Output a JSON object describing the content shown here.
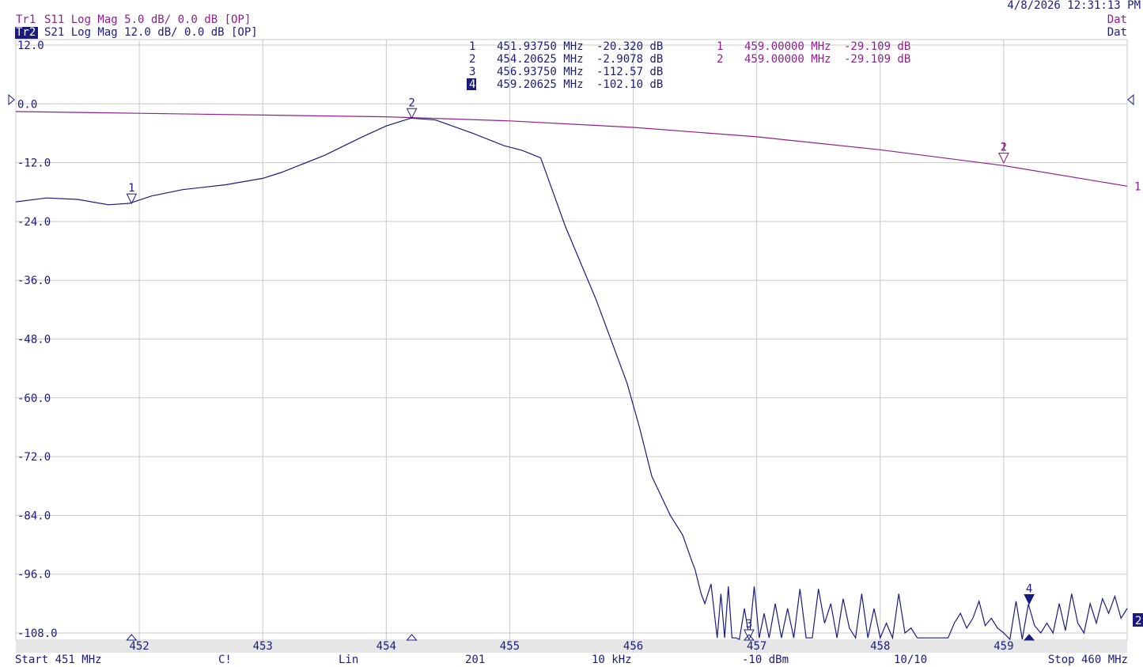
{
  "header": {
    "datetime": "4/8/2026 12:31:13 PM",
    "trace1": {
      "tag": "Tr1",
      "text": "S11 Log Mag 5.0 dB/ 0.0 dB [OP]",
      "status": "Dat"
    },
    "trace2": {
      "tag": "Tr2",
      "text": "S21 Log Mag 12.0 dB/ 0.0 dB [OP]",
      "status": "Dat"
    }
  },
  "footer": {
    "start": "Start 451 MHz",
    "cal": "C!",
    "sweep_type": "Lin",
    "points": "201",
    "ifbw": "10 kHz",
    "power": "-10 dBm",
    "averaging": "10/10",
    "stop": "Stop 460 MHz"
  },
  "marker_table_s21": [
    {
      "num": "1",
      "freq": "451.93750 MHz",
      "value": "-20.320 dB"
    },
    {
      "num": "2",
      "freq": "454.20625 MHz",
      "value": "-2.9078 dB"
    },
    {
      "num": "3",
      "freq": "456.93750 MHz",
      "value": "-112.57 dB"
    },
    {
      "num": "4",
      "freq": "459.20625 MHz",
      "value": "-102.10 dB"
    }
  ],
  "marker_table_s11": [
    {
      "num": "1",
      "freq": "459.00000 MHz",
      "value": "-29.109 dB"
    },
    {
      "num": "2",
      "freq": "459.00000 MHz",
      "value": "-29.109 dB"
    }
  ],
  "colors": {
    "s21": "#1b1b7f",
    "s11": "#8f1f8f",
    "grid": "#c8c8c8",
    "text": "#1b1b7f"
  },
  "chart_data": {
    "type": "line",
    "xlim": [
      451,
      460
    ],
    "ylim": [
      -108,
      12
    ],
    "x_ticks": [
      452,
      453,
      454,
      455,
      456,
      457,
      458,
      459
    ],
    "y_ticks": [
      12.0,
      0.0,
      -12.0,
      -24.0,
      -36.0,
      -48.0,
      -60.0,
      -72.0,
      -84.0,
      -96.0,
      -108.0
    ],
    "y_tick_labels": [
      "12.0",
      "0.0",
      "-12.0",
      "-24.0",
      "-36.0",
      "-48.0",
      "-60.0",
      "-72.0",
      "-84.0",
      "-96.0",
      "-108.0"
    ],
    "grid": true,
    "series": [
      {
        "trace": "S21",
        "end_label": "2",
        "x": [
          451.0,
          451.25,
          451.5,
          451.75,
          451.92,
          452.1,
          452.35,
          452.7,
          453.0,
          453.15,
          453.5,
          453.8,
          454.0,
          454.2,
          454.4,
          454.7,
          454.95,
          455.1,
          455.25,
          455.45,
          455.7,
          455.95,
          456.05,
          456.15,
          456.3,
          456.4,
          456.47,
          456.5,
          456.55,
          456.58,
          456.63,
          456.68,
          456.71,
          456.74,
          456.77,
          456.8,
          456.83,
          456.86,
          456.9,
          456.94,
          456.98,
          457.02,
          457.06,
          457.1,
          457.15,
          457.2,
          457.25,
          457.3,
          457.35,
          457.4,
          457.45,
          457.5,
          457.55,
          457.6,
          457.65,
          457.7,
          457.75,
          457.8,
          457.85,
          457.9,
          457.95,
          458.0,
          458.05,
          458.1,
          458.15,
          458.2,
          458.25,
          458.3,
          458.35,
          458.4,
          458.45,
          458.5,
          458.55,
          458.6,
          458.65,
          458.7,
          458.75,
          458.8,
          458.85,
          458.9,
          458.95,
          459.0,
          459.05,
          459.1,
          459.15,
          459.2,
          459.25,
          459.3,
          459.35,
          459.4,
          459.45,
          459.5,
          459.55,
          459.6,
          459.65,
          459.7,
          459.75,
          459.8,
          459.85,
          459.9,
          459.95,
          460.0
        ],
        "y": [
          -20.0,
          -19.2,
          -19.5,
          -20.6,
          -20.3,
          -18.8,
          -17.5,
          -16.5,
          -15.2,
          -14.0,
          -10.5,
          -6.8,
          -4.5,
          -2.9,
          -3.3,
          -6.0,
          -8.5,
          -9.5,
          -11.0,
          -25.0,
          -40.0,
          -57.0,
          -66.0,
          -76.0,
          -84.0,
          -88.0,
          -93.0,
          -95.0,
          -100.0,
          -102.0,
          -98.0,
          -109.0,
          -100.0,
          -109.0,
          -98.5,
          -109.0,
          -109.0,
          -112.5,
          -103.0,
          -109.0,
          -98.5,
          -109.0,
          -104.0,
          -109.0,
          -102.0,
          -109.0,
          -103.0,
          -109.0,
          -99.0,
          -109.0,
          -109.0,
          -99.0,
          -106.0,
          -102.0,
          -109.0,
          -101.0,
          -107.0,
          -109.0,
          -100.0,
          -109.0,
          -103.0,
          -109.0,
          -106.0,
          -109.0,
          -100.0,
          -108.0,
          -107.0,
          -109.0,
          -109.0,
          -109.0,
          -109.0,
          -109.0,
          -109.0,
          -106.0,
          -104.0,
          -107.0,
          -105.0,
          -101.5,
          -106.5,
          -105.0,
          -107.0,
          -108.0,
          -110.0,
          -101.5,
          -110.0,
          -102.1,
          -106.5,
          -108.0,
          -106.0,
          -108.0,
          -102.0,
          -107.5,
          -100.0,
          -106.0,
          -108.0,
          -102.0,
          -106.0,
          -101.0,
          -104.0,
          -100.5,
          -105.0,
          -103.0
        ]
      },
      {
        "trace": "S11",
        "end_label": "1",
        "x": [
          451.0,
          452.0,
          453.0,
          454.0,
          455.0,
          456.0,
          457.0,
          458.0,
          459.0,
          460.0
        ],
        "y": [
          -0.65,
          -0.8,
          -0.95,
          -1.1,
          -1.45,
          -2.0,
          -2.8,
          -3.9,
          -5.25,
          -7.0
        ],
        "y_scale_db_per_div": 5.0
      }
    ],
    "markers": [
      {
        "trace": "S21",
        "num": "1",
        "x": 451.9375,
        "y": -20.32,
        "active": false
      },
      {
        "trace": "S21",
        "num": "2",
        "x": 454.20625,
        "y": -2.9078,
        "active": false
      },
      {
        "trace": "S21",
        "num": "3",
        "x": 456.9375,
        "y": -112.57,
        "active": false
      },
      {
        "trace": "S21",
        "num": "4",
        "x": 459.20625,
        "y": -102.1,
        "active": true
      },
      {
        "trace": "S11",
        "num": "1",
        "x": 459.0,
        "y": -29.109,
        "active": false
      },
      {
        "trace": "S11",
        "num": "2",
        "x": 459.0,
        "y": -29.109,
        "active": false
      }
    ],
    "reference_level": "0.0"
  }
}
